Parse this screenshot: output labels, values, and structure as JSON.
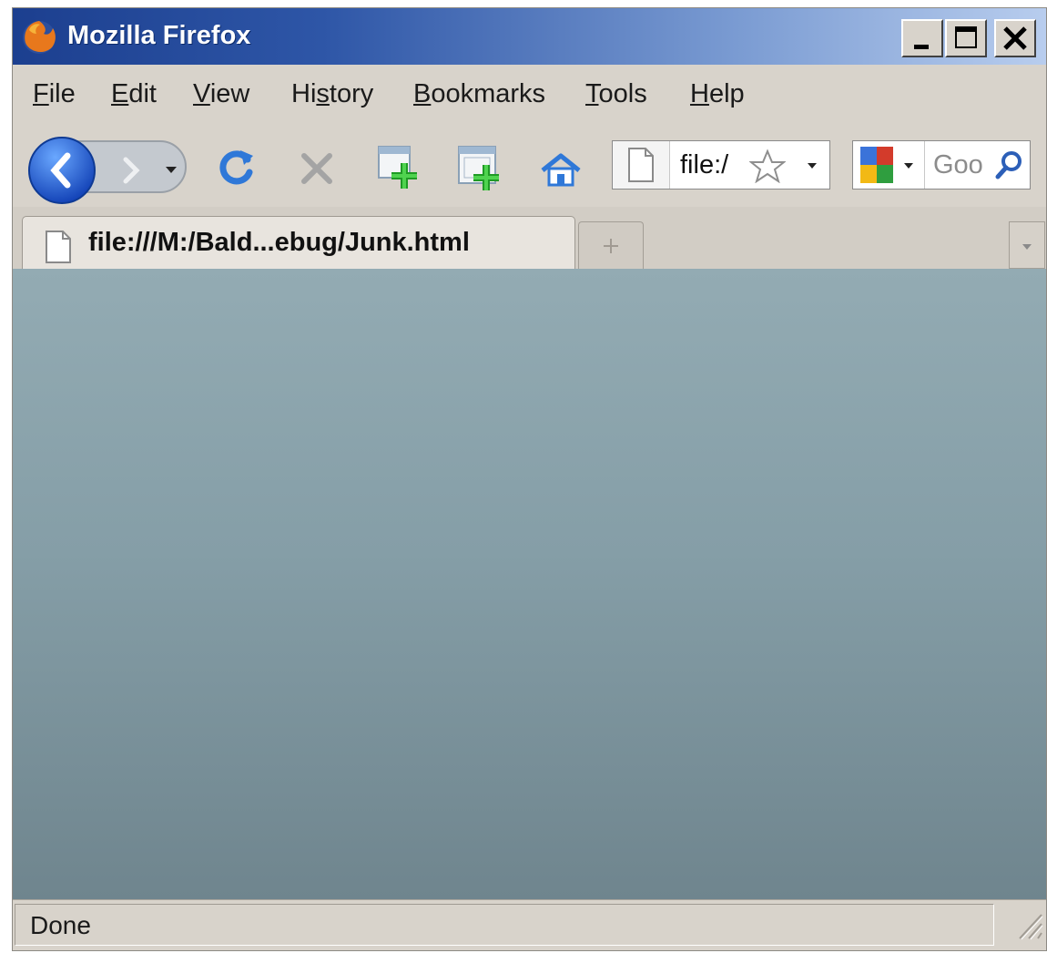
{
  "window": {
    "title": "Mozilla Firefox",
    "controls": {
      "minimize_icon": "minimize-icon",
      "maximize_icon": "maximize-icon",
      "close_icon": "close-icon"
    }
  },
  "menu": {
    "items": [
      {
        "label": "File",
        "mnemonic": "F"
      },
      {
        "label": "Edit",
        "mnemonic": "E"
      },
      {
        "label": "View",
        "mnemonic": "V"
      },
      {
        "label": "History",
        "mnemonic": "s"
      },
      {
        "label": "Bookmarks",
        "mnemonic": "B"
      },
      {
        "label": "Tools",
        "mnemonic": "T"
      },
      {
        "label": "Help",
        "mnemonic": "H"
      }
    ]
  },
  "toolbar": {
    "icons": [
      "back-icon",
      "forward-icon",
      "history-dropdown-icon",
      "reload-icon",
      "stop-icon",
      "new-tab-icon",
      "new-window-icon",
      "home-icon"
    ],
    "url": "file:/",
    "search_placeholder": "Goo"
  },
  "tabs": {
    "active": {
      "label": "file:///M:/Bald...ebug/Junk.html"
    }
  },
  "status": {
    "text": "Done"
  },
  "colors": {
    "title_start": "#1c3f8f",
    "title_end": "#b8cdee",
    "chrome": "#d8d3cb",
    "content_top": "#93abb3",
    "content_bottom": "#6f858e"
  }
}
